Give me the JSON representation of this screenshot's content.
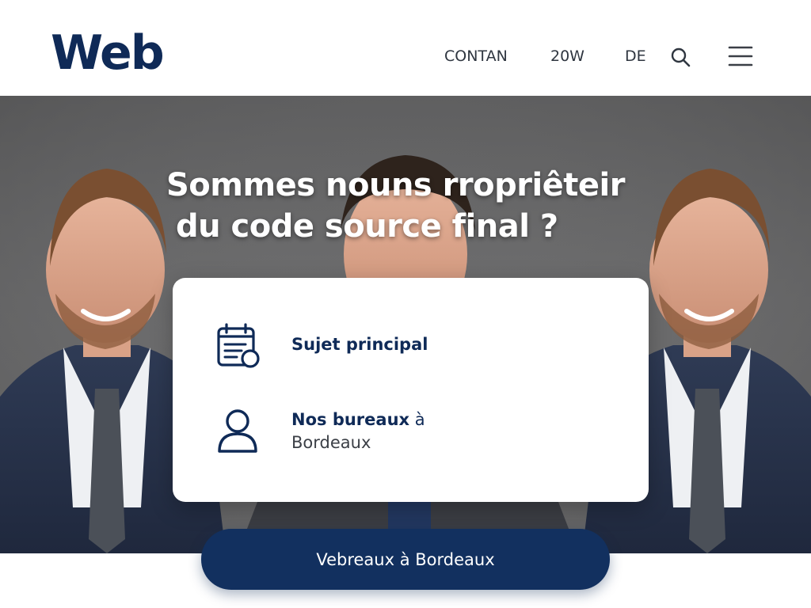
{
  "header": {
    "logo": "Web",
    "nav": [
      "CONTAN",
      "20W",
      "DE"
    ],
    "search_icon": "search-icon",
    "menu_icon": "hamburger-menu-icon"
  },
  "hero": {
    "title_line1": "Sommes nouns rropriêteir",
    "title_line2": "du code source final ?",
    "background": "photo of three smiling men in suits"
  },
  "card": {
    "items": [
      {
        "icon": "calendar-document-icon",
        "label": "Sujet principal"
      },
      {
        "icon": "user-icon",
        "label_bold": "Nos bureaux",
        "label_rest": " à",
        "sublabel": "Bordeaux"
      }
    ]
  },
  "cta": {
    "label": "Vebreaux à Bordeaux"
  },
  "colors": {
    "brand_navy": "#0f2a57",
    "cta_navy": "#12305f",
    "hero_gray": "#6b6b6c",
    "white": "#ffffff"
  }
}
